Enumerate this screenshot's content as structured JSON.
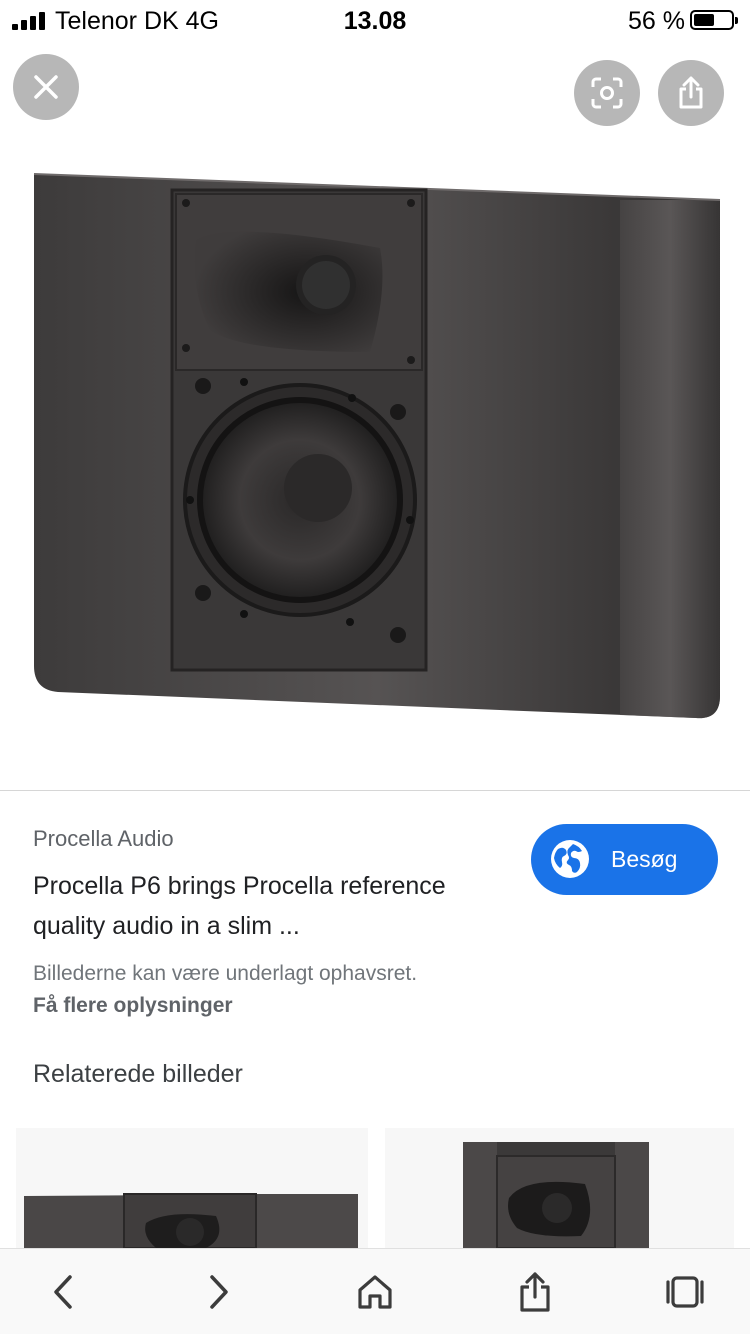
{
  "status_bar": {
    "carrier": "Telenor DK   4G",
    "time": "13.08",
    "battery_percent": "56 %",
    "battery_level": 0.56
  },
  "top_buttons": {
    "close_icon": "close-icon",
    "lens_icon": "lens-icon",
    "share_icon": "share-icon"
  },
  "result": {
    "source": "Procella Audio",
    "title": "Procella P6 brings Procella reference quality audio in a slim ...",
    "visit_label": "Besøg",
    "copyright_notice": "Billederne kan være underlagt ophavsret.",
    "more_info_link": "Få flere oplysninger"
  },
  "related": {
    "heading": "Relaterede billeder"
  },
  "toolbar": {
    "back_icon": "chevron-left-icon",
    "forward_icon": "chevron-right-icon",
    "home_icon": "home-icon",
    "share_icon": "share-icon",
    "tabs_icon": "tabs-icon"
  },
  "colors": {
    "accent": "#1a73e8",
    "button_gray": "#b7b7b7"
  }
}
